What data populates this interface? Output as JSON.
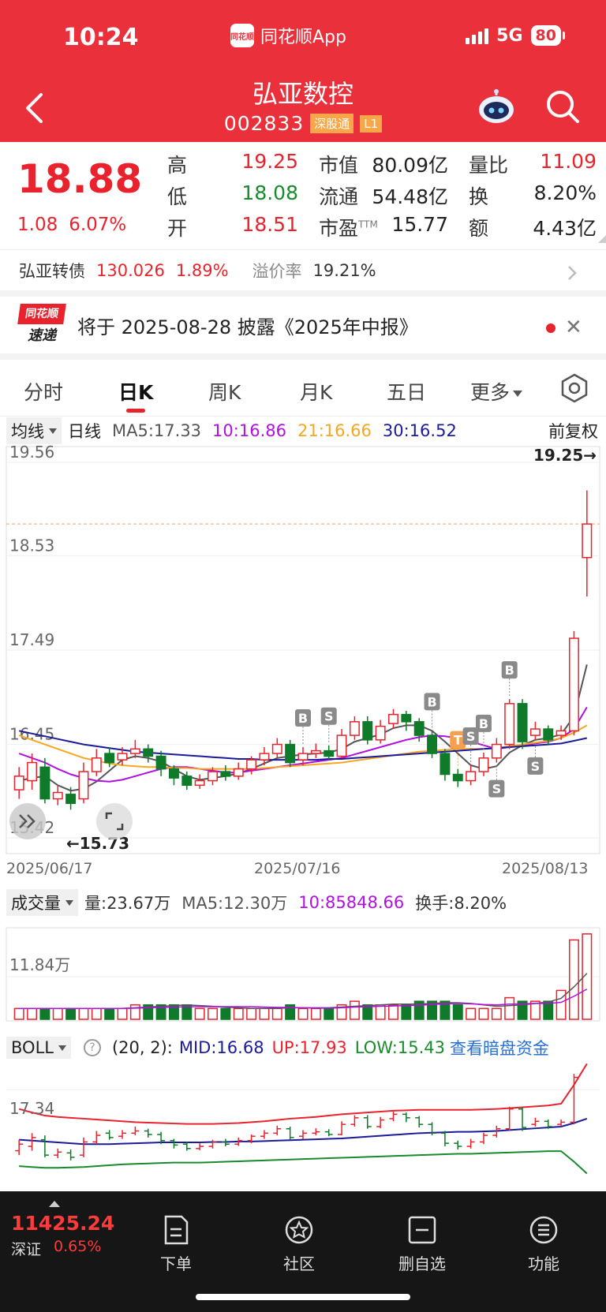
{
  "status_bar": {
    "time": "10:24",
    "app_name": "同花顺App",
    "network": "5G",
    "battery": "80",
    "logo_text": "同花顺"
  },
  "header": {
    "stock_name": "弘亚数控",
    "stock_code": "002833",
    "tag_connect": "深股通",
    "tag_level": "L1"
  },
  "quote": {
    "price": "18.88",
    "change": "1.08",
    "change_pct": "6.07%",
    "high_label": "高",
    "high": "19.25",
    "low_label": "低",
    "low": "18.08",
    "open_label": "开",
    "open": "18.51",
    "mktcap_label": "市值",
    "mktcap": "80.09亿",
    "float_label": "流通",
    "float": "54.48亿",
    "pe_label": "市盈",
    "pe_sup": "TTM",
    "pe": "15.77",
    "volratio_label": "量比",
    "volratio": "11.09",
    "turnover_label": "换",
    "turnover": "8.20%",
    "amount_label": "额",
    "amount": "4.43亿"
  },
  "bond": {
    "name": "弘亚转债",
    "price": "130.026",
    "pct": "1.89%",
    "premium_label": "溢价率",
    "premium": "19.21%"
  },
  "news": {
    "badge_top": "同花顺",
    "badge_bottom": "速递",
    "text": "将于 2025-08-28 披露《2025年中报》"
  },
  "tabs": [
    "分时",
    "日K",
    "周K",
    "月K",
    "五日",
    "更多"
  ],
  "active_tab": "日K",
  "ma_bar": {
    "button": "均线",
    "period": "日线",
    "ma5": "MA5:17.33",
    "ma10": "10:16.86",
    "ma20": "21:16.66",
    "ma30": "30:16.52",
    "adjust": "前复权"
  },
  "vol_bar": {
    "button": "成交量",
    "vol": "量:23.67万",
    "ma5": "MA5:12.30万",
    "ma10": "10:85848.66",
    "turn": "换手:8.20%"
  },
  "boll_bar": {
    "button": "BOLL",
    "params": "(20, 2):",
    "mid": "MID:16.68",
    "up": "UP:17.93",
    "low": "LOW:15.43",
    "link": "查看暗盘资金"
  },
  "colors": {
    "up": "#e8232d",
    "down": "#0f7a2a",
    "ma5": "#555555",
    "ma10": "#b010e0",
    "ma20": "#f5a623",
    "ma30": "#1b1b9a",
    "header": "#ea303b"
  },
  "chart_data": [
    {
      "type": "candlestick",
      "title": "",
      "period": "日线",
      "y_ticks": [
        "19.56",
        "18.53",
        "17.49",
        "16.45",
        "15.42"
      ],
      "ylim": [
        15.42,
        19.56
      ],
      "x_ticks": [
        "2025/06/17",
        "2025/07/16",
        "2025/08/13"
      ],
      "max_label": "19.25→",
      "min_label": "←15.73",
      "reference_line": 18.88,
      "candles": [
        {
          "o": 15.95,
          "c": 16.1,
          "h": 16.2,
          "l": 15.85
        },
        {
          "o": 16.05,
          "c": 16.25,
          "h": 16.35,
          "l": 15.95
        },
        {
          "o": 16.2,
          "c": 15.85,
          "h": 16.3,
          "l": 15.8
        },
        {
          "o": 15.85,
          "c": 15.92,
          "h": 16.0,
          "l": 15.78
        },
        {
          "o": 15.9,
          "c": 15.8,
          "h": 15.98,
          "l": 15.73
        },
        {
          "o": 15.85,
          "c": 16.15,
          "h": 16.25,
          "l": 15.8
        },
        {
          "o": 16.15,
          "c": 16.3,
          "h": 16.4,
          "l": 16.1
        },
        {
          "o": 16.35,
          "c": 16.25,
          "h": 16.42,
          "l": 16.2
        },
        {
          "o": 16.28,
          "c": 16.35,
          "h": 16.42,
          "l": 16.22
        },
        {
          "o": 16.35,
          "c": 16.4,
          "h": 16.5,
          "l": 16.3
        },
        {
          "o": 16.4,
          "c": 16.32,
          "h": 16.45,
          "l": 16.25
        },
        {
          "o": 16.32,
          "c": 16.18,
          "h": 16.38,
          "l": 16.1
        },
        {
          "o": 16.18,
          "c": 16.08,
          "h": 16.22,
          "l": 16.0
        },
        {
          "o": 16.1,
          "c": 16.0,
          "h": 16.15,
          "l": 15.95
        },
        {
          "o": 16.0,
          "c": 16.05,
          "h": 16.12,
          "l": 15.96
        },
        {
          "o": 16.05,
          "c": 16.15,
          "h": 16.2,
          "l": 16.0
        },
        {
          "o": 16.15,
          "c": 16.1,
          "h": 16.22,
          "l": 16.05
        },
        {
          "o": 16.1,
          "c": 16.18,
          "h": 16.25,
          "l": 16.06
        },
        {
          "o": 16.18,
          "c": 16.28,
          "h": 16.32,
          "l": 16.12
        },
        {
          "o": 16.28,
          "c": 16.35,
          "h": 16.42,
          "l": 16.22
        },
        {
          "o": 16.35,
          "c": 16.45,
          "h": 16.52,
          "l": 16.3
        },
        {
          "o": 16.45,
          "c": 16.25,
          "h": 16.5,
          "l": 16.2
        },
        {
          "o": 16.28,
          "c": 16.35,
          "h": 16.42,
          "l": 16.22
        },
        {
          "o": 16.35,
          "c": 16.38,
          "h": 16.46,
          "l": 16.3
        },
        {
          "o": 16.38,
          "c": 16.32,
          "h": 16.44,
          "l": 16.28
        },
        {
          "o": 16.32,
          "c": 16.55,
          "h": 16.62,
          "l": 16.3
        },
        {
          "o": 16.55,
          "c": 16.7,
          "h": 16.76,
          "l": 16.5
        },
        {
          "o": 16.7,
          "c": 16.5,
          "h": 16.76,
          "l": 16.45
        },
        {
          "o": 16.5,
          "c": 16.65,
          "h": 16.72,
          "l": 16.46
        },
        {
          "o": 16.68,
          "c": 16.78,
          "h": 16.84,
          "l": 16.62
        },
        {
          "o": 16.78,
          "c": 16.7,
          "h": 16.82,
          "l": 16.6
        },
        {
          "o": 16.7,
          "c": 16.55,
          "h": 16.74,
          "l": 16.48
        },
        {
          "o": 16.55,
          "c": 16.35,
          "h": 16.6,
          "l": 16.3
        },
        {
          "o": 16.35,
          "c": 16.12,
          "h": 16.4,
          "l": 16.05
        },
        {
          "o": 16.12,
          "c": 16.05,
          "h": 16.18,
          "l": 15.98
        },
        {
          "o": 16.05,
          "c": 16.15,
          "h": 16.22,
          "l": 16.0
        },
        {
          "o": 16.15,
          "c": 16.3,
          "h": 16.36,
          "l": 16.1
        },
        {
          "o": 16.3,
          "c": 16.45,
          "h": 16.52,
          "l": 16.25
        },
        {
          "o": 16.45,
          "c": 16.9,
          "h": 16.95,
          "l": 16.4
        },
        {
          "o": 16.9,
          "c": 16.48,
          "h": 16.95,
          "l": 16.4
        },
        {
          "o": 16.55,
          "c": 16.62,
          "h": 16.7,
          "l": 16.5
        },
        {
          "o": 16.62,
          "c": 16.5,
          "h": 16.66,
          "l": 16.45
        },
        {
          "o": 16.55,
          "c": 16.6,
          "h": 16.66,
          "l": 16.5
        },
        {
          "o": 16.6,
          "c": 17.62,
          "h": 17.7,
          "l": 16.55
        },
        {
          "o": 18.51,
          "c": 18.88,
          "h": 19.25,
          "l": 18.08
        }
      ],
      "series": [
        {
          "name": "MA5",
          "values": [
            16.05,
            16.08,
            16.1,
            16.0,
            15.94,
            15.96,
            16.04,
            16.16,
            16.28,
            16.32,
            16.3,
            16.26,
            16.18,
            16.1,
            16.06,
            16.08,
            16.1,
            16.13,
            16.18,
            16.24,
            16.3,
            16.32,
            16.34,
            16.35,
            16.36,
            16.4,
            16.48,
            16.52,
            16.56,
            16.63,
            16.66,
            16.66,
            16.6,
            16.48,
            16.35,
            16.22,
            16.18,
            16.21,
            16.36,
            16.44,
            16.5,
            16.52,
            16.56,
            16.76,
            17.33
          ]
        },
        {
          "name": "MA10",
          "values": [
            16.35,
            16.3,
            16.25,
            16.18,
            16.12,
            16.08,
            16.05,
            16.04,
            16.06,
            16.1,
            16.14,
            16.18,
            16.2,
            16.2,
            16.18,
            16.16,
            16.14,
            16.14,
            16.16,
            16.18,
            16.2,
            16.22,
            16.24,
            16.26,
            16.28,
            16.3,
            16.34,
            16.38,
            16.42,
            16.46,
            16.5,
            16.53,
            16.55,
            16.54,
            16.52,
            16.48,
            16.44,
            16.4,
            16.42,
            16.44,
            16.46,
            16.48,
            16.52,
            16.62,
            16.86
          ]
        },
        {
          "name": "MA20",
          "values": [
            16.55,
            16.5,
            16.45,
            16.4,
            16.35,
            16.3,
            16.27,
            16.24,
            16.22,
            16.21,
            16.2,
            16.2,
            16.19,
            16.19,
            16.18,
            16.18,
            16.18,
            16.18,
            16.18,
            16.19,
            16.2,
            16.21,
            16.22,
            16.23,
            16.24,
            16.25,
            16.27,
            16.29,
            16.31,
            16.33,
            16.35,
            16.37,
            16.38,
            16.39,
            16.4,
            16.4,
            16.4,
            16.41,
            16.43,
            16.45,
            16.47,
            16.49,
            16.52,
            16.58,
            16.66
          ]
        },
        {
          "name": "MA30",
          "values": [
            16.6,
            16.57,
            16.54,
            16.51,
            16.48,
            16.45,
            16.43,
            16.41,
            16.39,
            16.37,
            16.36,
            16.35,
            16.34,
            16.33,
            16.32,
            16.31,
            16.3,
            16.29,
            16.29,
            16.28,
            16.28,
            16.28,
            16.28,
            16.28,
            16.29,
            16.29,
            16.3,
            16.31,
            16.32,
            16.33,
            16.34,
            16.35,
            16.36,
            16.37,
            16.38,
            16.39,
            16.4,
            16.41,
            16.42,
            16.43,
            16.44,
            16.45,
            16.46,
            16.49,
            16.52
          ]
        }
      ],
      "signals": [
        {
          "i": 22,
          "label": "B",
          "pos": "above"
        },
        {
          "i": 24,
          "label": "S",
          "pos": "above"
        },
        {
          "i": 32,
          "label": "B",
          "pos": "above"
        },
        {
          "i": 34,
          "label": "T",
          "pos": "above"
        },
        {
          "i": 35,
          "label": "S",
          "pos": "above"
        },
        {
          "i": 36,
          "label": "B",
          "pos": "above"
        },
        {
          "i": 37,
          "label": "S",
          "pos": "below"
        },
        {
          "i": 38,
          "label": "B",
          "pos": "above"
        },
        {
          "i": 40,
          "label": "S",
          "pos": "below"
        }
      ]
    },
    {
      "type": "bar",
      "title": "成交量",
      "y_ticks": [
        "11.84万"
      ],
      "values": [
        3,
        3,
        3,
        3,
        3,
        3,
        3,
        3,
        3,
        4,
        4,
        4,
        4,
        4,
        3,
        3,
        3,
        3,
        3,
        3,
        3,
        4,
        3,
        3,
        3,
        4,
        5,
        4,
        4,
        4,
        4,
        5,
        5,
        5,
        4,
        3,
        3,
        3,
        6,
        5,
        5,
        5,
        8,
        22,
        23.67
      ],
      "up": [
        1,
        1,
        0,
        1,
        0,
        1,
        1,
        0,
        1,
        1,
        0,
        0,
        0,
        0,
        1,
        1,
        0,
        1,
        1,
        1,
        1,
        0,
        1,
        1,
        0,
        1,
        1,
        0,
        1,
        1,
        0,
        0,
        0,
        0,
        0,
        1,
        1,
        1,
        1,
        0,
        1,
        0,
        1,
        1,
        1
      ]
    },
    {
      "type": "line",
      "title": "BOLL",
      "y_ticks": [
        "17.34"
      ],
      "series": [
        {
          "name": "MID",
          "values": [
            16.2,
            16.18,
            16.16,
            16.14,
            16.12,
            16.1,
            16.1,
            16.1,
            16.11,
            16.12,
            16.13,
            16.14,
            16.14,
            16.14,
            16.14,
            16.15,
            16.15,
            16.16,
            16.16,
            16.17,
            16.18,
            16.19,
            16.2,
            16.21,
            16.22,
            16.23,
            16.25,
            16.27,
            16.29,
            16.31,
            16.33,
            16.35,
            16.36,
            16.37,
            16.38,
            16.38,
            16.39,
            16.4,
            16.42,
            16.44,
            16.46,
            16.48,
            16.5,
            16.58,
            16.68
          ]
        },
        {
          "name": "UP",
          "values": [
            16.9,
            16.82,
            16.75,
            16.72,
            16.7,
            16.68,
            16.66,
            16.64,
            16.62,
            16.6,
            16.59,
            16.58,
            16.57,
            16.56,
            16.56,
            16.56,
            16.57,
            16.58,
            16.6,
            16.62,
            16.65,
            16.68,
            16.7,
            16.72,
            16.75,
            16.78,
            16.8,
            16.82,
            16.84,
            16.86,
            16.87,
            16.88,
            16.88,
            16.88,
            16.88,
            16.88,
            16.89,
            16.9,
            16.92,
            16.94,
            16.96,
            16.98,
            17.02,
            17.45,
            17.93
          ]
        },
        {
          "name": "LOW",
          "values": [
            15.6,
            15.58,
            15.56,
            15.56,
            15.57,
            15.58,
            15.6,
            15.62,
            15.64,
            15.65,
            15.66,
            15.67,
            15.68,
            15.68,
            15.68,
            15.69,
            15.7,
            15.71,
            15.72,
            15.73,
            15.74,
            15.75,
            15.76,
            15.77,
            15.78,
            15.79,
            15.8,
            15.81,
            15.82,
            15.83,
            15.84,
            15.85,
            15.86,
            15.87,
            15.88,
            15.88,
            15.89,
            15.9,
            15.91,
            15.92,
            15.93,
            15.94,
            15.94,
            15.7,
            15.43
          ]
        }
      ]
    }
  ],
  "bottom_nav": {
    "index_value": "11425.24",
    "index_name": "深证",
    "index_pct": "0.65%",
    "items": [
      {
        "label": "下单",
        "icon": "order-icon"
      },
      {
        "label": "社区",
        "icon": "community-icon"
      },
      {
        "label": "删自选",
        "icon": "remove-watchlist-icon"
      },
      {
        "label": "功能",
        "icon": "menu-icon"
      }
    ]
  }
}
